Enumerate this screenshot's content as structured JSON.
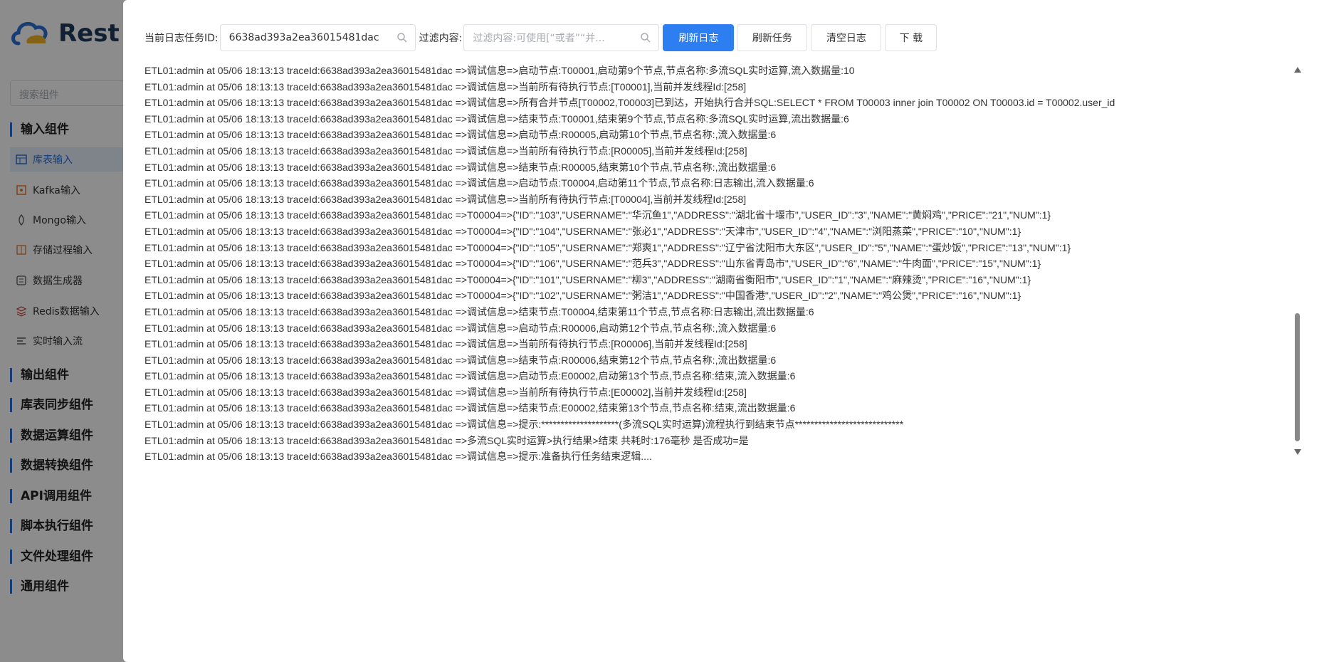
{
  "background_app": {
    "brand_text": "Rest",
    "search_placeholder": "搜索组件",
    "groups": [
      {
        "label": "输入组件"
      },
      {
        "label": "输出组件"
      },
      {
        "label": "库表同步组件"
      },
      {
        "label": "数据运算组件"
      },
      {
        "label": "数据转换组件"
      },
      {
        "label": "API调用组件"
      },
      {
        "label": "脚本执行组件"
      },
      {
        "label": "文件处理组件"
      },
      {
        "label": "通用组件"
      }
    ],
    "input_items": [
      {
        "label": "库表输入",
        "icon": "table-icon",
        "active": true
      },
      {
        "label": "Kafka输入",
        "icon": "kafka-icon"
      },
      {
        "label": "Mongo输入",
        "icon": "mongo-icon"
      },
      {
        "label": "存储过程输入",
        "icon": "procedure-icon"
      },
      {
        "label": "数据生成器",
        "icon": "generator-icon"
      },
      {
        "label": "Redis数据输入",
        "icon": "redis-icon"
      },
      {
        "label": "实时输入流",
        "icon": "stream-icon"
      }
    ]
  },
  "drawer": {
    "task_id_label": "当前日志任务ID:",
    "task_id_value": "6638ad393a2ea36015481dac",
    "filter_label": "过滤内容:",
    "filter_placeholder": "过滤内容:可使用[“或者”“并...",
    "buttons": {
      "refresh_log": "刷新日志",
      "refresh_task": "刷新任务",
      "clear_log": "清空日志",
      "download": "下 载"
    },
    "colors": {
      "primary": "#2d7ef0"
    },
    "log_lines": [
      "ETL01:admin at 05/06 18:13:13 traceId:6638ad393a2ea36015481dac =>调试信息=>启动节点:T00001,启动第9个节点,节点名称:多流SQL实时运算,流入数据量:10",
      "ETL01:admin at 05/06 18:13:13 traceId:6638ad393a2ea36015481dac =>调试信息=>当前所有待执行节点:[T00001],当前并发线程Id:[258]",
      "ETL01:admin at 05/06 18:13:13 traceId:6638ad393a2ea36015481dac =>调试信息=>所有合并节点[T00002,T00003]已到达，开始执行合并SQL:SELECT * FROM T00003 inner join T00002 ON T00003.id = T00002.user_id",
      "ETL01:admin at 05/06 18:13:13 traceId:6638ad393a2ea36015481dac =>调试信息=>结束节点:T00001,结束第9个节点,节点名称:多流SQL实时运算,流出数据量:6",
      "ETL01:admin at 05/06 18:13:13 traceId:6638ad393a2ea36015481dac =>调试信息=>启动节点:R00005,启动第10个节点,节点名称:,流入数据量:6",
      "ETL01:admin at 05/06 18:13:13 traceId:6638ad393a2ea36015481dac =>调试信息=>当前所有待执行节点:[R00005],当前并发线程Id:[258]",
      "ETL01:admin at 05/06 18:13:13 traceId:6638ad393a2ea36015481dac =>调试信息=>结束节点:R00005,结束第10个节点,节点名称:,流出数据量:6",
      "ETL01:admin at 05/06 18:13:13 traceId:6638ad393a2ea36015481dac =>调试信息=>启动节点:T00004,启动第11个节点,节点名称:日志输出,流入数据量:6",
      "ETL01:admin at 05/06 18:13:13 traceId:6638ad393a2ea36015481dac =>调试信息=>当前所有待执行节点:[T00004],当前并发线程Id:[258]",
      "ETL01:admin at 05/06 18:13:13 traceId:6638ad393a2ea36015481dac =>T00004=>{\"ID\":\"103\",\"USERNAME\":\"华沉鱼1\",\"ADDRESS\":\"湖北省十堰市\",\"USER_ID\":\"3\",\"NAME\":\"黄焖鸡\",\"PRICE\":\"21\",\"NUM\":1}",
      "ETL01:admin at 05/06 18:13:13 traceId:6638ad393a2ea36015481dac =>T00004=>{\"ID\":\"104\",\"USERNAME\":\"张必1\",\"ADDRESS\":\"天津市\",\"USER_ID\":\"4\",\"NAME\":\"浏阳蒸菜\",\"PRICE\":\"10\",\"NUM\":1}",
      "ETL01:admin at 05/06 18:13:13 traceId:6638ad393a2ea36015481dac =>T00004=>{\"ID\":\"105\",\"USERNAME\":\"郑爽1\",\"ADDRESS\":\"辽宁省沈阳市大东区\",\"USER_ID\":\"5\",\"NAME\":\"蛋炒饭\",\"PRICE\":\"13\",\"NUM\":1}",
      "ETL01:admin at 05/06 18:13:13 traceId:6638ad393a2ea36015481dac =>T00004=>{\"ID\":\"106\",\"USERNAME\":\"范兵3\",\"ADDRESS\":\"山东省青岛市\",\"USER_ID\":\"6\",\"NAME\":\"牛肉面\",\"PRICE\":\"15\",\"NUM\":1}",
      "ETL01:admin at 05/06 18:13:13 traceId:6638ad393a2ea36015481dac =>T00004=>{\"ID\":\"101\",\"USERNAME\":\"柳3\",\"ADDRESS\":\"湖南省衡阳市\",\"USER_ID\":\"1\",\"NAME\":\"麻辣烫\",\"PRICE\":\"16\",\"NUM\":1}",
      "ETL01:admin at 05/06 18:13:13 traceId:6638ad393a2ea36015481dac =>T00004=>{\"ID\":\"102\",\"USERNAME\":\"粥洁1\",\"ADDRESS\":\"中国香港\",\"USER_ID\":\"2\",\"NAME\":\"鸡公煲\",\"PRICE\":\"16\",\"NUM\":1}",
      "ETL01:admin at 05/06 18:13:13 traceId:6638ad393a2ea36015481dac =>调试信息=>结束节点:T00004,结束第11个节点,节点名称:日志输出,流出数据量:6",
      "ETL01:admin at 05/06 18:13:13 traceId:6638ad393a2ea36015481dac =>调试信息=>启动节点:R00006,启动第12个节点,节点名称:,流入数据量:6",
      "ETL01:admin at 05/06 18:13:13 traceId:6638ad393a2ea36015481dac =>调试信息=>当前所有待执行节点:[R00006],当前并发线程Id:[258]",
      "ETL01:admin at 05/06 18:13:13 traceId:6638ad393a2ea36015481dac =>调试信息=>结束节点:R00006,结束第12个节点,节点名称:,流出数据量:6",
      "ETL01:admin at 05/06 18:13:13 traceId:6638ad393a2ea36015481dac =>调试信息=>启动节点:E00002,启动第13个节点,节点名称:结束,流入数据量:6",
      "ETL01:admin at 05/06 18:13:13 traceId:6638ad393a2ea36015481dac =>调试信息=>当前所有待执行节点:[E00002],当前并发线程Id:[258]",
      "ETL01:admin at 05/06 18:13:13 traceId:6638ad393a2ea36015481dac =>调试信息=>结束节点:E00002,结束第13个节点,节点名称:结束,流出数据量:6",
      "ETL01:admin at 05/06 18:13:13 traceId:6638ad393a2ea36015481dac =>调试信息=>提示:********************(多流SQL实时运算)流程执行到结束节点****************************",
      "ETL01:admin at 05/06 18:13:13 traceId:6638ad393a2ea36015481dac =>多流SQL实时运算>执行结果>结束 共耗时:176毫秒 是否成功=是",
      "ETL01:admin at 05/06 18:13:13 traceId:6638ad393a2ea36015481dac =>调试信息=>提示:准备执行任务结束逻辑...."
    ]
  }
}
